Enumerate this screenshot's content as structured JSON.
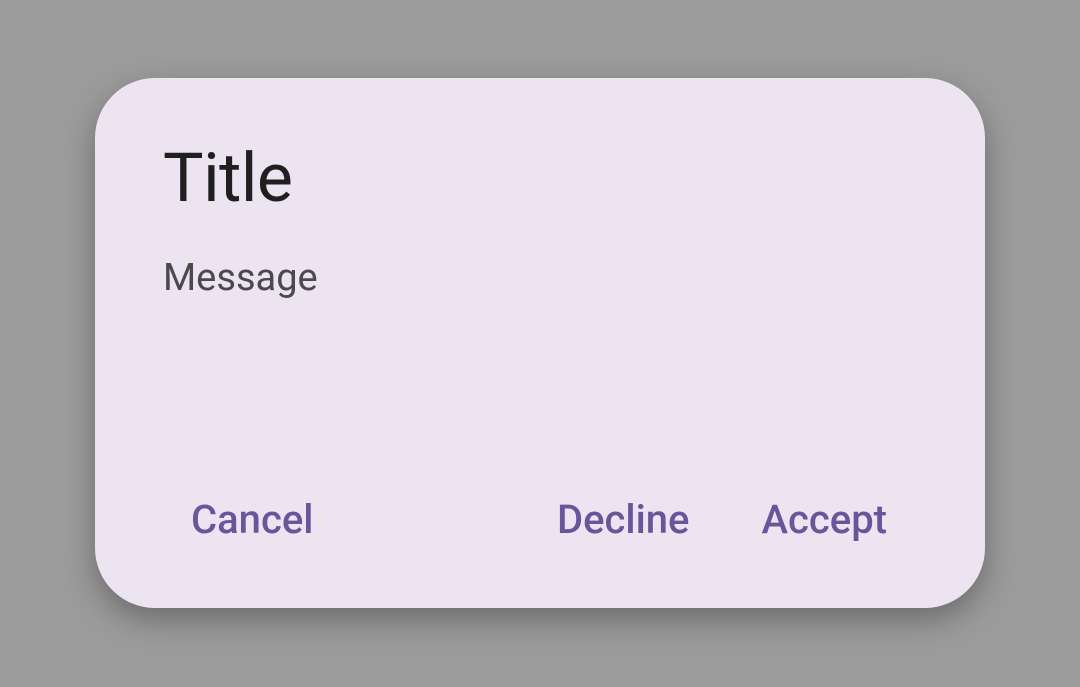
{
  "dialog": {
    "title": "Title",
    "message": "Message",
    "buttons": {
      "cancel": "Cancel",
      "decline": "Decline",
      "accept": "Accept"
    }
  },
  "colors": {
    "backdrop": "#9b9b9b",
    "dialog_bg": "#ece4f1",
    "title_color": "#1f1f1f",
    "message_color": "#4a4a4a",
    "button_color": "#6a549a"
  }
}
